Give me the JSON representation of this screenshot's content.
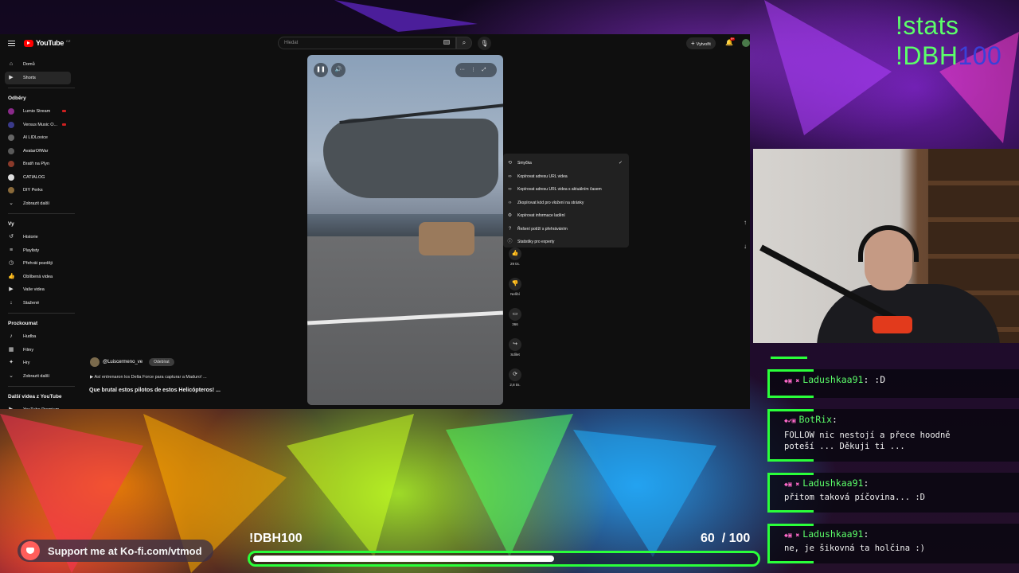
{
  "overlay": {
    "cmd_stats": "!stats",
    "cmd_dbh": "!DBH",
    "cmd_dbh_num": "100"
  },
  "youtube": {
    "logo_text": "YouTube",
    "logo_sup": "CZ",
    "search_placeholder": "Hledat",
    "create_label": "Vytvořit",
    "bell_badge": "9+",
    "sidebar": {
      "main": [
        {
          "label": "Domů",
          "icon": "home-icon"
        },
        {
          "label": "Shorts",
          "icon": "shorts-icon"
        }
      ],
      "subs_heading": "Odběry",
      "subs": [
        {
          "label": "Lumio Stream",
          "color": "#8a2a8a",
          "live": true
        },
        {
          "label": "Versus Music O...",
          "color": "#3a3a8a",
          "live": true
        },
        {
          "label": "Al LIDLovice",
          "color": "#666666",
          "live": false
        },
        {
          "label": "AvatarOfWar",
          "color": "#5a5a5a",
          "live": false
        },
        {
          "label": "Bratři na Plyn",
          "color": "#8a3a2a",
          "live": false
        },
        {
          "label": "CATIALOG",
          "color": "#dddddd",
          "live": false
        },
        {
          "label": "DIY Perks",
          "color": "#8a6a3a",
          "live": false
        },
        {
          "label": "Zobrazit další",
          "color": "",
          "live": false
        }
      ],
      "you_heading": "Vy",
      "you": [
        {
          "label": "Historie",
          "icon": "history-icon"
        },
        {
          "label": "Playlisty",
          "icon": "playlist-icon"
        },
        {
          "label": "Přehrát později",
          "icon": "watch-later-icon"
        },
        {
          "label": "Oblíbená videa",
          "icon": "like-icon"
        },
        {
          "label": "Vaše videa",
          "icon": "video-icon"
        },
        {
          "label": "Stažené",
          "icon": "download-icon"
        }
      ],
      "explore_heading": "Prozkoumat",
      "explore": [
        {
          "label": "Hudba",
          "icon": "music-icon"
        },
        {
          "label": "Filmy",
          "icon": "film-icon"
        },
        {
          "label": "Hry",
          "icon": "game-icon"
        },
        {
          "label": "Zobrazit další",
          "icon": "chevron-down-icon"
        }
      ],
      "more_heading": "Další videa z YouTube",
      "more": [
        {
          "label": "YouTube Premium",
          "icon": "premium-icon"
        }
      ]
    },
    "context_menu": [
      {
        "label": "Smyčka",
        "icon": "loop-icon",
        "checked": true
      },
      {
        "label": "Kopírovat adresu URL videa",
        "icon": "link-icon",
        "checked": false
      },
      {
        "label": "Kopírovat adresu URL videa s aktuálním časem",
        "icon": "link-time-icon",
        "checked": false
      },
      {
        "label": "Zkopírovat kód pro vložení na stránky",
        "icon": "embed-icon",
        "checked": false
      },
      {
        "label": "Kopírovat informace ladění",
        "icon": "debug-icon",
        "checked": false
      },
      {
        "label": "Řešení potíží s přehráváním",
        "icon": "help-icon",
        "checked": false
      },
      {
        "label": "Statistiky pro experty",
        "icon": "info-icon",
        "checked": false
      }
    ],
    "actions": [
      {
        "label": "29 tis.",
        "icon": "thumbs-up-icon"
      },
      {
        "label": "Nelíbí",
        "icon": "thumbs-down-icon"
      },
      {
        "label": "366",
        "icon": "comment-icon"
      },
      {
        "label": "Sdílet",
        "icon": "share-icon"
      },
      {
        "label": "2,8 tis.",
        "icon": "remix-icon"
      }
    ],
    "channel_name": "@Luiscermeno_ve",
    "subscribe_label": "Odebírat",
    "subtitle": "Así entrenaron los Delta Force para capturar a Maduro! ...",
    "video_title": "Que brutal estos pilotos de estos Helicópteros! ..."
  },
  "chat": [
    {
      "user": "Ladushkaa91",
      "text": ":D"
    },
    {
      "user": "BotRix",
      "text": "FOLLOW nic nestojí a přece hoodně\npoteší ... Děkuji ti ..."
    },
    {
      "user": "Ladushkaa91",
      "text": "přitom taková píčovina... :D"
    },
    {
      "user": "Ladushkaa91",
      "text": "ne, je šikovná ta holčina :)"
    }
  ],
  "bottom": {
    "kofi_text": "Support me at Ko-fi.com/vtmod",
    "goal_label": "!DBH100",
    "goal_current": 60,
    "goal_total": 100,
    "goal_count_text": "60  / 100"
  },
  "colors": {
    "accent_green": "#2aff3a",
    "youtube_red": "#ff0000"
  }
}
